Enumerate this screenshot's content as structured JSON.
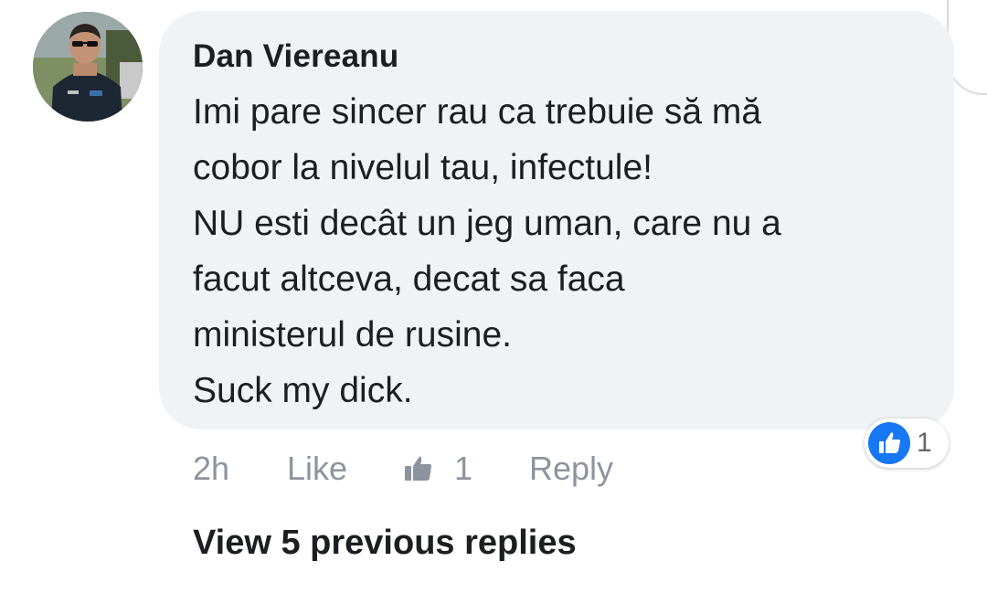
{
  "comment": {
    "author": "Dan Viereanu",
    "lines": [
      "Imi pare sincer rau ca trebuie să mă",
      "cobor la nivelul tau, infectule!",
      "NU esti decât un jeg uman, care nu a",
      "facut altceva, decat sa faca",
      "ministerul de rusine.",
      "Suck my dick."
    ],
    "reaction_count": "1"
  },
  "actions": {
    "time": "2h",
    "like": "Like",
    "like_count": "1",
    "reply": "Reply"
  },
  "view_replies": "View 5 previous replies",
  "colors": {
    "bubble": "#f0f2f5",
    "text": "#1c1e21",
    "muted": "#8d949e",
    "accent": "#1877f2"
  },
  "icons": {
    "avatar": "profile-photo",
    "reaction": "thumbs-up-icon",
    "like_count_icon": "thumbs-up-outline-icon"
  }
}
